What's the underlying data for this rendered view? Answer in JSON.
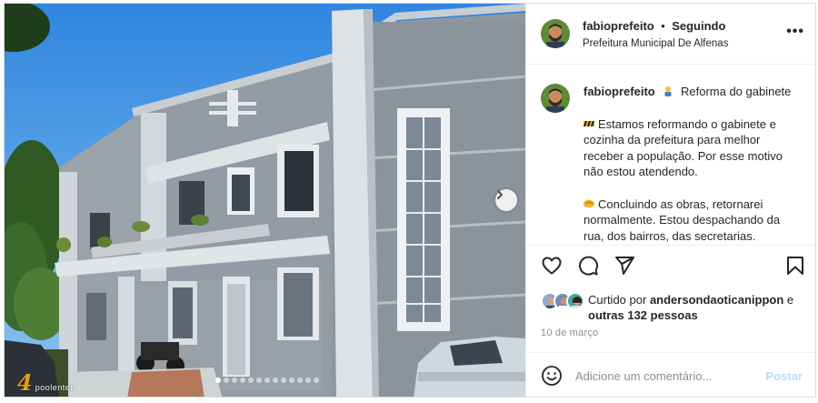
{
  "header": {
    "username": "fabioprefeito",
    "separator": "•",
    "follow_status": "Seguindo",
    "location": "Prefeitura Municipal De Alfenas",
    "more_label": "•••"
  },
  "caption": {
    "username": "fabioprefeito",
    "title": "Reforma do gabinete",
    "paragraph1": "Estamos reformando o gabinete e cozinha da prefeitura para melhor receber a população. Por esse motivo não estou atendendo.",
    "paragraph2": "Concluindo as obras, retornarei normalmente. Estou despachando da rua, dos bairros, das secretarias."
  },
  "likes": {
    "prefix": "Curtido por",
    "liker": "andersondaoticanippon",
    "connector": "e",
    "others": "outras 132 pessoas"
  },
  "date": "10 de março",
  "comment": {
    "placeholder": "Adicione um comentário...",
    "post_label": "Postar"
  },
  "watermark": {
    "number": "4",
    "text": "poolenter"
  },
  "carousel": {
    "total_slides": 13,
    "active_slide": 1
  },
  "icons": {
    "like": "heart-icon",
    "comment": "comment-icon",
    "share": "paper-plane-icon",
    "save": "bookmark-icon",
    "emoji": "smiley-icon",
    "next": "chevron-right-icon"
  },
  "colors": {
    "text": "#262626",
    "muted": "#8e8e8e",
    "post_disabled": "#b2dffc",
    "border": "#dbdbdb"
  }
}
